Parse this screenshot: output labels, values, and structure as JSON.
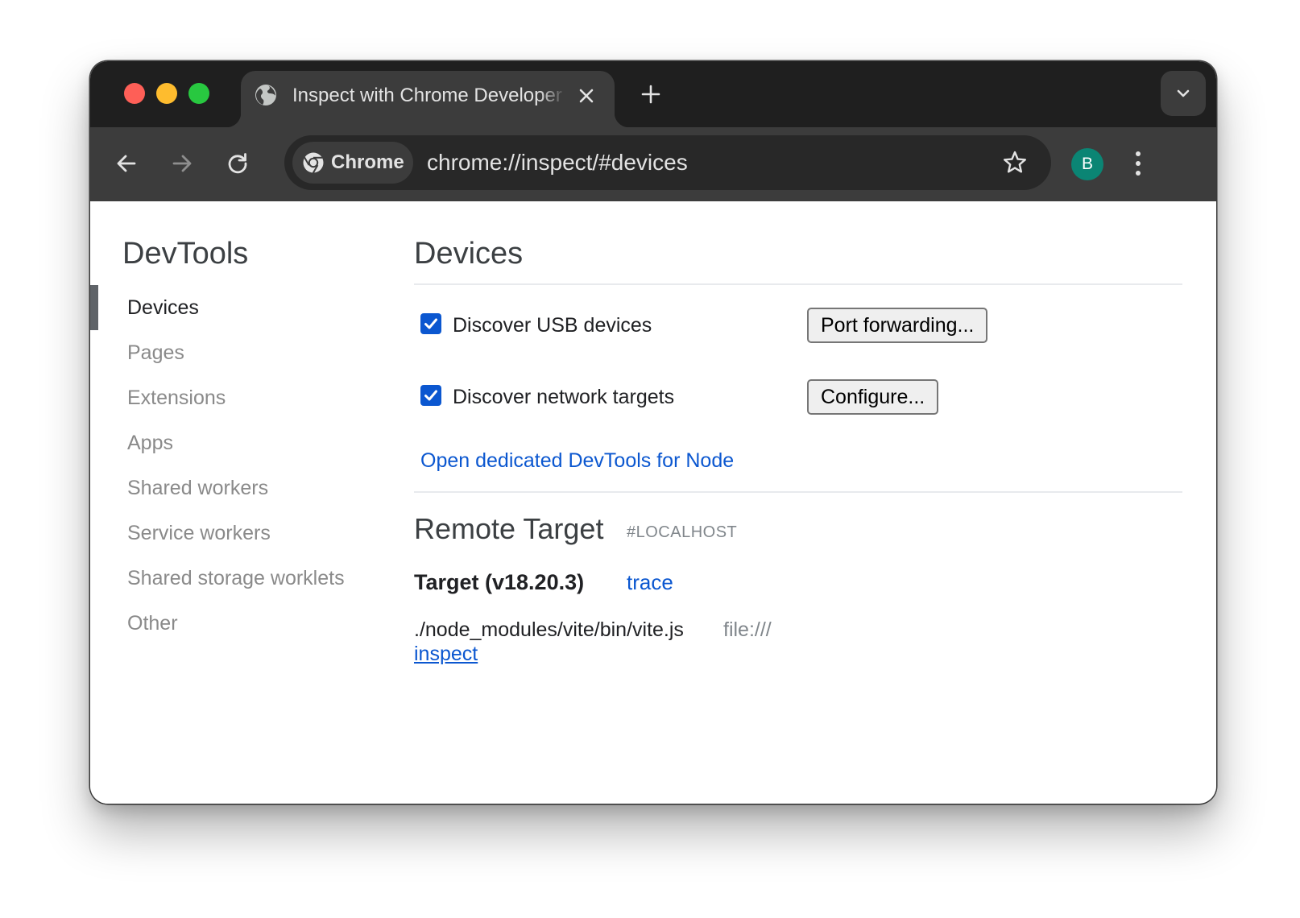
{
  "browser": {
    "tab_title": "Inspect with Chrome Developer Tools",
    "omnibox_chip_label": "Chrome",
    "url": "chrome://inspect/#devices",
    "profile_initial": "B",
    "icons": [
      "globe-icon",
      "close-icon",
      "plus-icon",
      "chevron-down-icon",
      "back-arrow-icon",
      "forward-arrow-icon",
      "reload-icon",
      "chrome-logo-icon",
      "star-icon",
      "more-vert-icon"
    ]
  },
  "sidebar": {
    "title": "DevTools",
    "items": [
      {
        "label": "Devices",
        "active": true
      },
      {
        "label": "Pages",
        "active": false
      },
      {
        "label": "Extensions",
        "active": false
      },
      {
        "label": "Apps",
        "active": false
      },
      {
        "label": "Shared workers",
        "active": false
      },
      {
        "label": "Service workers",
        "active": false
      },
      {
        "label": "Shared storage worklets",
        "active": false
      },
      {
        "label": "Other",
        "active": false
      }
    ]
  },
  "main": {
    "title": "Devices",
    "discover_usb": {
      "label": "Discover USB devices",
      "checked": true,
      "button": "Port forwarding..."
    },
    "discover_network": {
      "label": "Discover network targets",
      "checked": true,
      "button": "Configure..."
    },
    "node_link": "Open dedicated DevTools for Node",
    "remote": {
      "title": "Remote Target",
      "tag": "#LOCALHOST",
      "target_name": "Target (v18.20.3)",
      "trace_link": "trace",
      "path": "./node_modules/vite/bin/vite.js",
      "url": "file:///",
      "inspect_link": "inspect"
    }
  },
  "colors": {
    "titlebar": "#1f1f1f",
    "toolbar": "#3c3c3c",
    "link": "#0b57d0",
    "checkbox": "#0b57d0",
    "avatar": "#0b8574"
  }
}
